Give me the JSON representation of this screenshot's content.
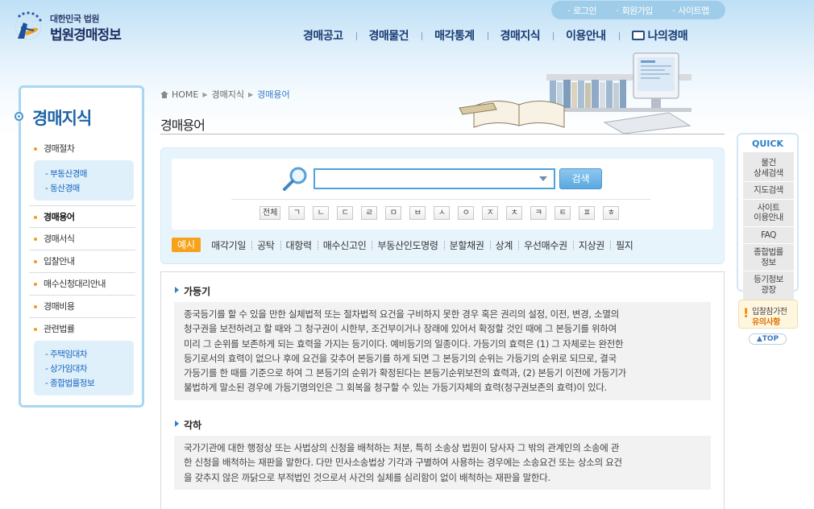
{
  "header": {
    "logo_sub": "대한민국 법원",
    "logo_main": "법원경매정보",
    "util_links": [
      "로그인",
      "회원가입",
      "사이트맵"
    ],
    "gnb": [
      "경매공고",
      "경매물건",
      "매각통계",
      "경매지식",
      "이용안내",
      "나의경매"
    ]
  },
  "lnb": {
    "title": "경매지식",
    "items": [
      {
        "label": "경매절차",
        "sub": [
          "부동산경매",
          "동산경매"
        ]
      },
      {
        "label": "경매용어",
        "active": true
      },
      {
        "label": "경매서식"
      },
      {
        "label": "입찰안내"
      },
      {
        "label": "매수신청대리안내"
      },
      {
        "label": "경매비용"
      },
      {
        "label": "관련법률",
        "sub": [
          "주택임대차",
          "상가임대차",
          "종합법률정보"
        ]
      }
    ]
  },
  "breadcrumb": {
    "home": "HOME",
    "level1": "경매지식",
    "level2": "경매용어"
  },
  "page_title": "경매용어",
  "search": {
    "input_value": "",
    "button": "검색",
    "consonants": [
      "전체",
      "ㄱ",
      "ㄴ",
      "ㄷ",
      "ㄹ",
      "ㅁ",
      "ㅂ",
      "ㅅ",
      "ㅇ",
      "ㅈ",
      "ㅊ",
      "ㅋ",
      "ㅌ",
      "ㅍ",
      "ㅎ"
    ],
    "example_label": "예시",
    "examples": [
      "매각기일",
      "공탁",
      "대항력",
      "매수신고인",
      "부동산인도명령",
      "분할채권",
      "상계",
      "우선매수권",
      "지상권",
      "필지"
    ]
  },
  "terms": [
    {
      "title": "가등기",
      "lines": [
        "종국등기를 할 수 있을 만한 실체법적 또는 절차법적 요건을 구비하지 못한 경우 혹은 권리의 설정, 이전, 변경, 소멸의",
        "청구권을 보전하려고 할 때와 그 청구권이 시한부, 조건부이거나 장래에 있어서 확정할 것인 때에 그 본등기를 위하여",
        "미리 그 순위를 보존하게 되는 효력을 가지는 등기이다. 예비등기의 일종이다. 가등기의 효력은 (1) 그 자체로는 완전한",
        "등기로서의 효력이 없으나 후에 요건을 갖추어 본등기를 하게 되면 그 본등기의 순위는 가등기의 순위로 되므로, 결국",
        "가등기를 한 때를 기준으로 하여 그 본등기의 순위가 확정된다는 본등기순위보전의 효력과, (2) 본등기 이전에 가등기가",
        "불법하게 말소된 경우에 가등기명의인은 그 회복을 청구할 수 있는 가등기자체의 효력(청구권보존의 효력)이 있다."
      ]
    },
    {
      "title": "각하",
      "lines": [
        "국가기관에 대한 행정상 또는 사법상의 신청을 배척하는 처분, 특히 소송상 법원이 당사자 그 밖의 관계인의 소송에 관",
        "한 신청을 배척하는 재판을 말한다. 다만 민사소송법상 기각과 구별하여 사용하는 경우에는 소송요건 또는 상소의 요건",
        "을 갖추지 않은 까닭으로 부적법인 것으로서 사건의 실체를 심리함이 없이 배척하는 재판을 말한다."
      ]
    }
  ],
  "quick": {
    "title": "QUICK",
    "items": [
      "물건\n상세검색",
      "지도검색",
      "사이트\n이용안내",
      "FAQ",
      "종합법률\n정보",
      "등기정보\n광장"
    ],
    "notice_l1": "입찰참가전",
    "notice_l2": "유의사항",
    "top": "TOP"
  }
}
